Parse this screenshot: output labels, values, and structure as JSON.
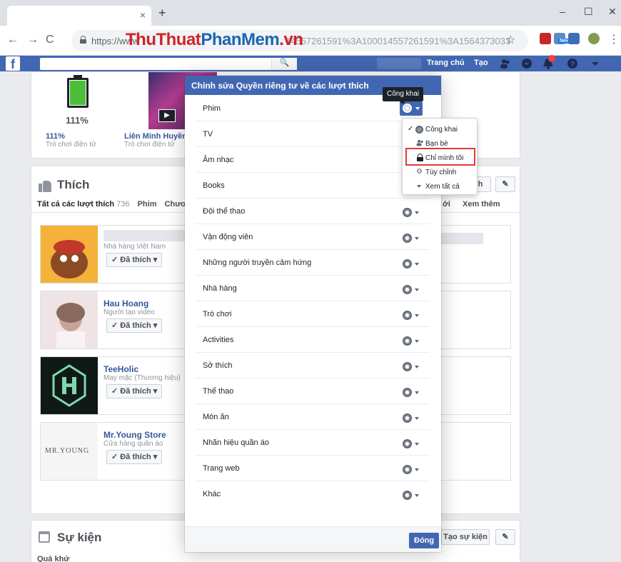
{
  "browser": {
    "tab_close": "×",
    "new_tab": "+",
    "window_controls": [
      "–",
      "☐",
      "✕"
    ],
    "nav": {
      "back": "←",
      "forward": "→",
      "reload": "C"
    },
    "url_prefix": "https://www",
    "url_rest": "14557261591%3A100014557261591%3A1564373033",
    "watermark_a": "ThuThuat",
    "watermark_b": "PhanMem",
    "watermark_c": ".vn",
    "bookmark_icon": "☆",
    "ext_badge": "New",
    "menu_icon": "⋮"
  },
  "fb_header": {
    "logo": "f",
    "search_icon": "🔍",
    "nav": [
      "Trang chủ",
      "Tạo"
    ]
  },
  "games": {
    "tiles": [
      {
        "pct_caption": "111%",
        "name": "111%",
        "category": "Trò chơi điện tử"
      },
      {
        "name": "Liên Minh Huyền...",
        "category": "Trò chơi điện tử"
      }
    ]
  },
  "likes": {
    "title": "Thích",
    "tabs_all": "Tất cả các lượt thích",
    "tabs_count": "736",
    "tabs": [
      "Phim",
      "Chươ"
    ],
    "tabs_right": [
      "ới",
      "Xem thêm"
    ],
    "header_btn_partial": "h",
    "items": [
      {
        "name": "",
        "subtitle": "Nhà hàng Việt Nam",
        "button": "✓ Đã thích ▾"
      },
      {
        "name": "Hau Hoang",
        "subtitle": "Người tạo video",
        "button": "✓ Đã thích ▾"
      },
      {
        "name": "TeeHolic",
        "subtitle": "May mặc (Thương hiệu)",
        "button": "✓ Đã thích ▾"
      },
      {
        "name": "Mr.Young Store",
        "subtitle": "Cửa hàng quần áo",
        "button": "✓ Đã thích ▾",
        "logo_text": "MR.YOUNG"
      }
    ]
  },
  "events": {
    "title": "Sự kiện",
    "subtitle": "Quá khứ",
    "create_btn": "Tạo sự kiện"
  },
  "modal": {
    "title": "Chỉnh sửa Quyền riêng tư về các lượt thích",
    "rows": [
      "Phim",
      "TV",
      "Âm nhạc",
      "Books",
      "Đội thể thao",
      "Vận động viên",
      "Những người truyền cảm hứng",
      "Nhà hàng",
      "Trò chơi",
      "Activities",
      "Sở thích",
      "Thể thao",
      "Món ăn",
      "Nhãn hiệu quần áo",
      "Trang web",
      "Khác"
    ],
    "close_button": "Đóng"
  },
  "tooltip": "Công khai",
  "audience_menu": {
    "items": [
      "Công khai",
      "Bạn bè",
      "Chỉ mình tôi",
      "Tùy chỉnh",
      "Xem tất cả"
    ],
    "selected": "Công khai",
    "highlighted": "Chỉ mình tôi"
  },
  "colors": {
    "fb_blue": "#4267b2",
    "link_blue": "#365899",
    "highlight_red": "#e53935"
  }
}
